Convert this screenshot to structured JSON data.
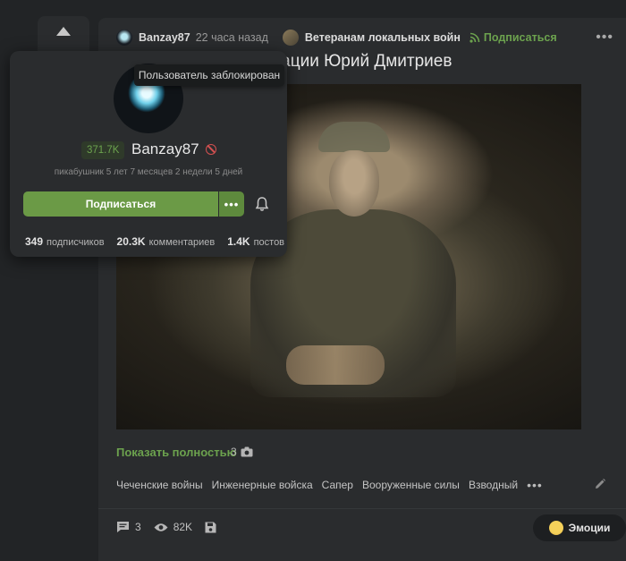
{
  "post": {
    "author": "Banzay87",
    "time": "22 часа назад",
    "community": "Ветеранам локальных войн",
    "subscribe_link": "Подписаться",
    "title_visible": "ерации Юрий Дмитриев",
    "show_full": "Показать полностью",
    "image_count": "3",
    "tags": [
      "Чеченские войны",
      "Инженерные войска",
      "Сапер",
      "Вооруженные силы",
      "Взводный"
    ],
    "tags_more": "•••",
    "top_more": "•••"
  },
  "footer": {
    "comments": "3",
    "views": "82K",
    "emotions_label": "Эмоции"
  },
  "popup": {
    "tooltip": "Пользователь заблокирован",
    "rating": "371.7K",
    "name": "Banzay87",
    "tenure": "пикабушник 5 лет 7 месяцев 2 недели 5 дней",
    "subscribe_button": "Подписаться",
    "more": "•••",
    "stats": {
      "subscribers_value": "349",
      "subscribers_label": "подписчиков",
      "comments_value": "20.3K",
      "comments_label": "комментариев",
      "posts_value": "1.4K",
      "posts_label": "постов"
    }
  },
  "colors": {
    "accent_green": "#6ca24e",
    "button_green": "#6b9a46",
    "background": "#222426",
    "card": "#2a2c2e",
    "ban_red": "#d35050"
  },
  "icons": [
    "arrow-up-icon",
    "rss-icon",
    "camera-icon",
    "pencil-icon",
    "comment-icon",
    "eye-icon",
    "save-icon",
    "bell-icon",
    "ban-icon",
    "emoji-icon",
    "more-icon"
  ]
}
